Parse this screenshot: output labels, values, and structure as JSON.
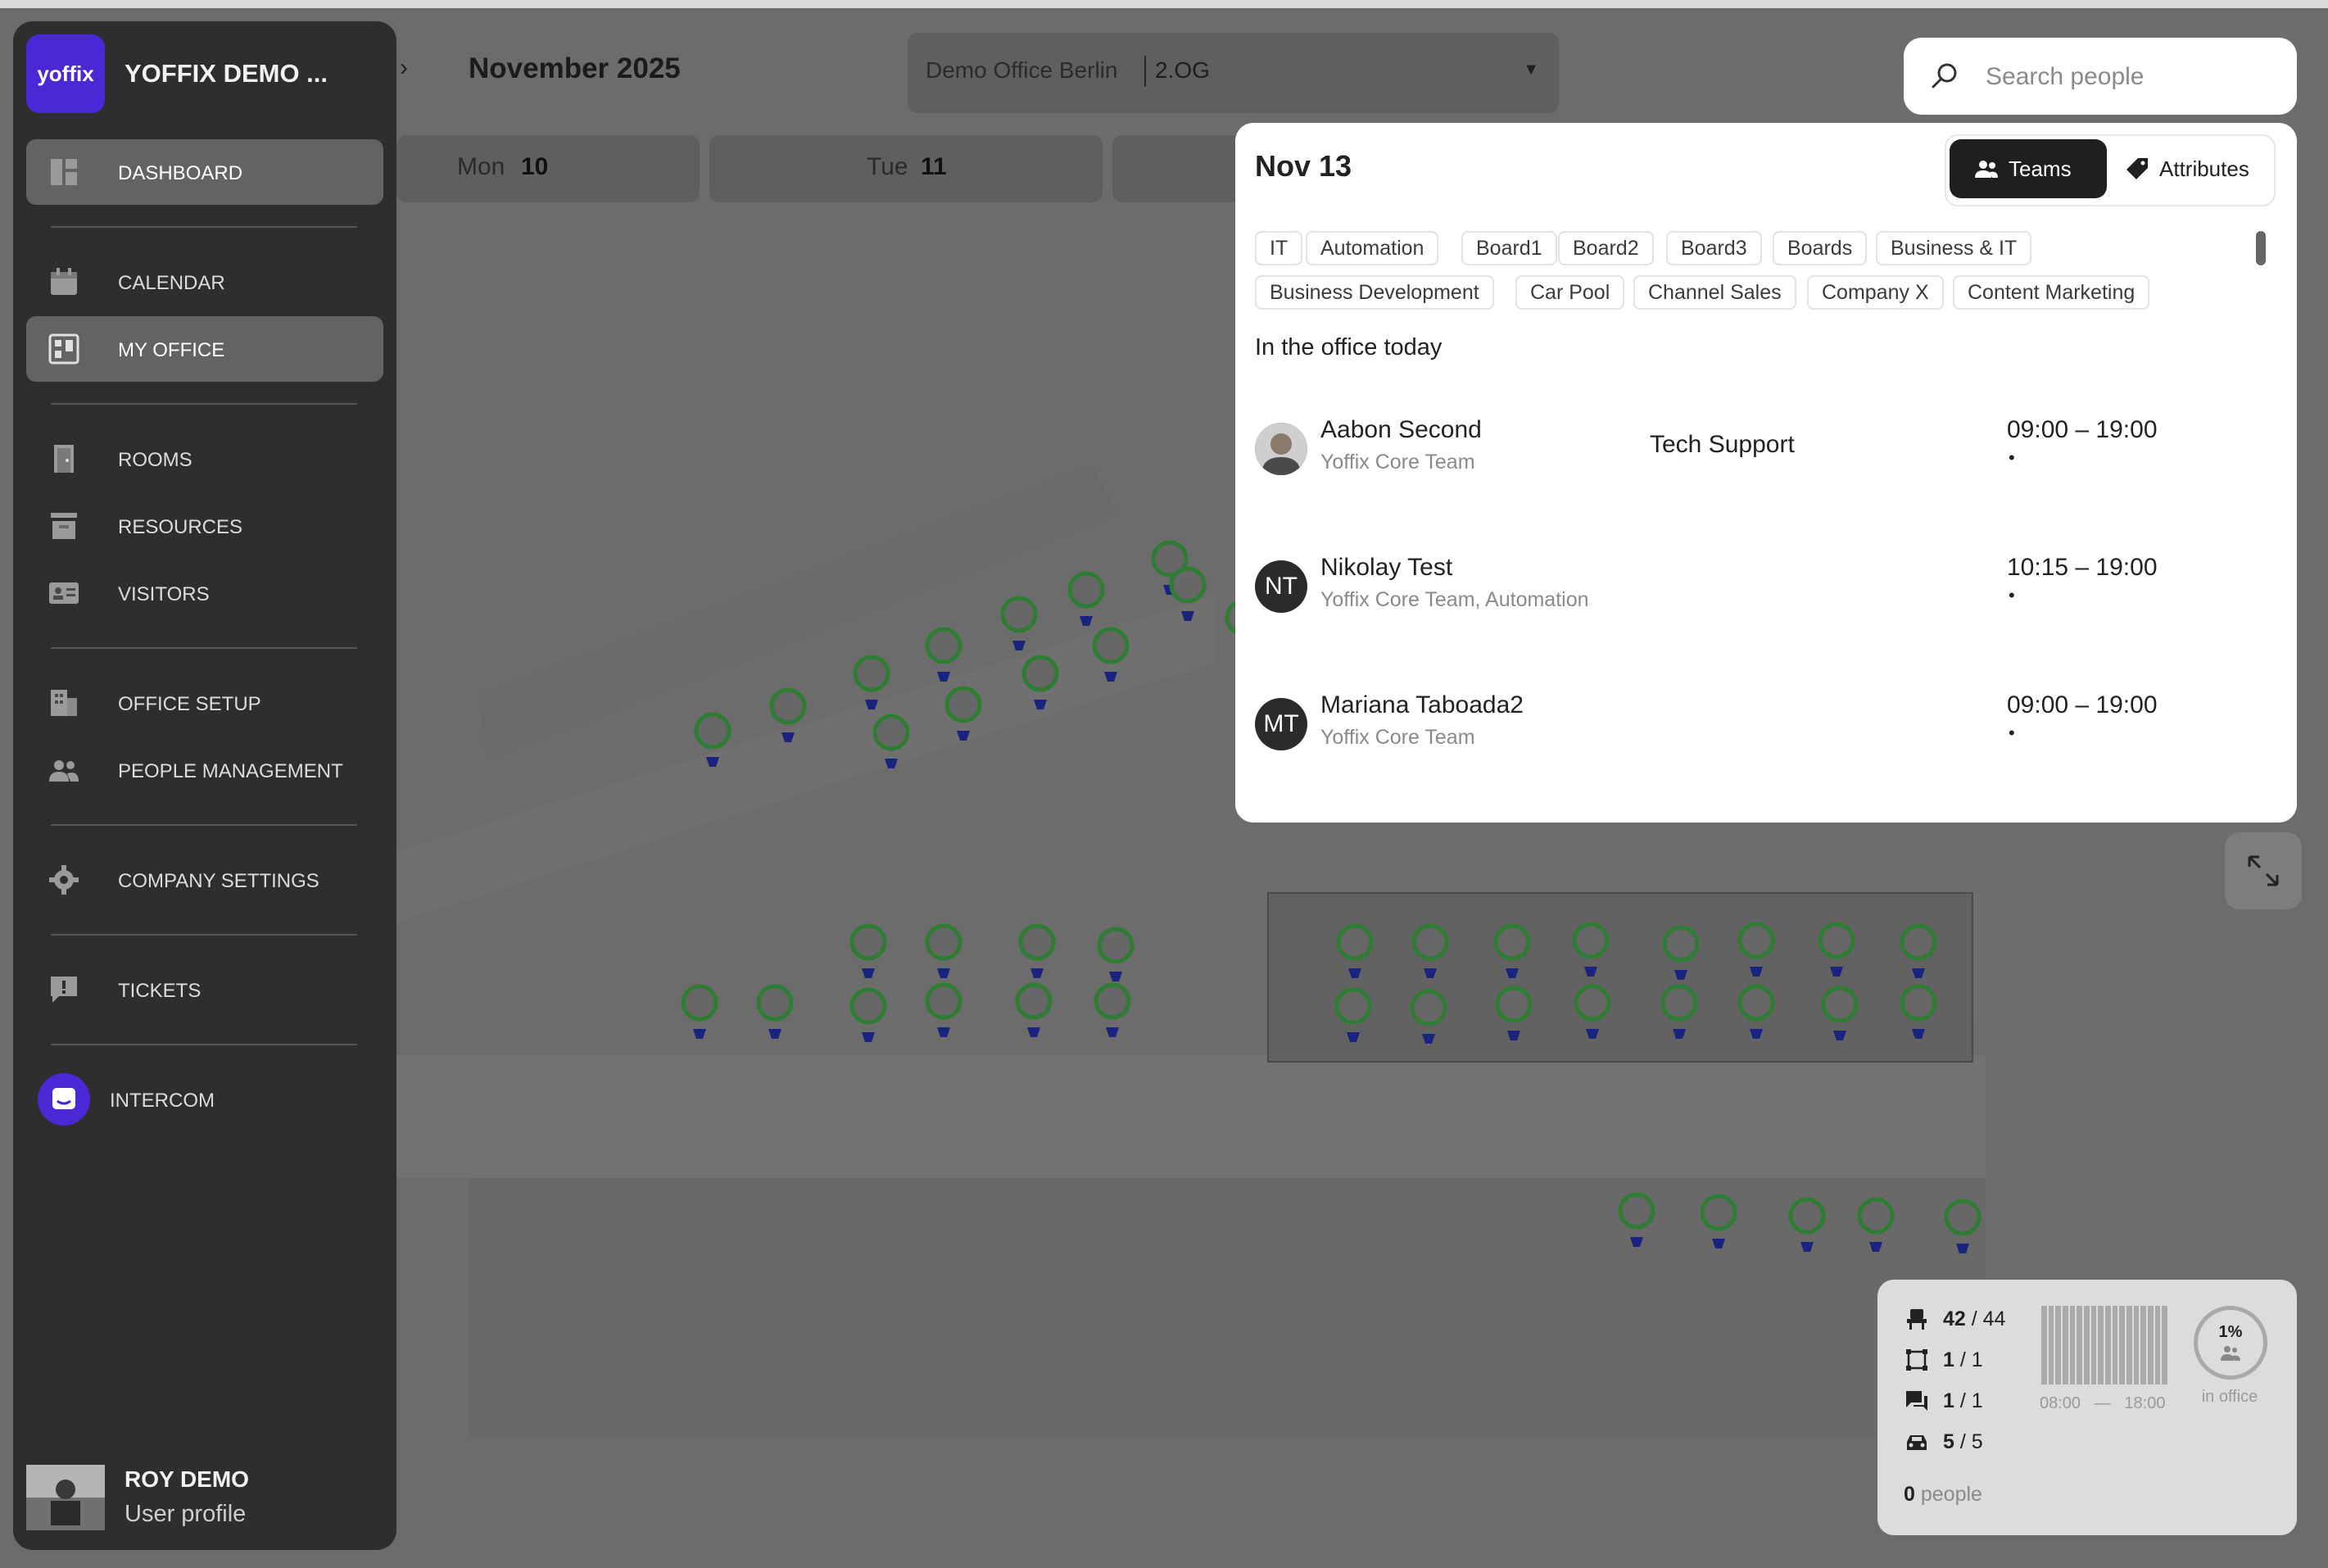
{
  "header": {
    "month_title": "November 2025",
    "location": "Demo Office Berlin",
    "floor": "2.OG",
    "search_placeholder": "Search people"
  },
  "days": [
    {
      "name": "Mon",
      "num": "10"
    },
    {
      "name": "Tue",
      "num": "11"
    }
  ],
  "sidebar": {
    "logo_text": "yoffix",
    "company": "YOFFIX DEMO ...",
    "items": [
      {
        "label": "DASHBOARD",
        "icon": "dashboard-icon"
      },
      {
        "label": "CALENDAR",
        "icon": "calendar-icon"
      },
      {
        "label": "MY OFFICE",
        "icon": "office-map-icon"
      },
      {
        "label": "ROOMS",
        "icon": "door-icon"
      },
      {
        "label": "RESOURCES",
        "icon": "resources-icon"
      },
      {
        "label": "VISITORS",
        "icon": "visitor-card-icon"
      },
      {
        "label": "OFFICE SETUP",
        "icon": "building-icon"
      },
      {
        "label": "PEOPLE MANAGEMENT",
        "icon": "people-icon"
      },
      {
        "label": "COMPANY SETTINGS",
        "icon": "gear-icon"
      },
      {
        "label": "TICKETS",
        "icon": "ticket-icon"
      }
    ],
    "intercom": "INTERCOM",
    "profile": {
      "name": "ROY DEMO",
      "sub": "User profile"
    }
  },
  "panel": {
    "date": "Nov 13",
    "seg_teams": "Teams",
    "seg_attributes": "Attributes",
    "tags": [
      "IT",
      "Automation",
      "Board1",
      "Board2",
      "Board3",
      "Boards",
      "Business & IT",
      "Business Development",
      "Car Pool",
      "Channel Sales",
      "Company X",
      "Content Marketing"
    ],
    "section_title": "In the office today",
    "people": [
      {
        "name": "Aabon Second",
        "team": "Yoffix Core Team",
        "desk": "Tech Support",
        "time": "09:00 – 19:00",
        "dot": "•",
        "initials": ""
      },
      {
        "name": "Nikolay Test",
        "team": "Yoffix Core Team, Automation",
        "desk": "",
        "time": "10:15 – 19:00",
        "dot": "•",
        "initials": "NT"
      },
      {
        "name": "Mariana Taboada2",
        "team": "Yoffix Core Team",
        "desk": "",
        "time": "09:00 – 19:00",
        "dot": "•",
        "initials": "MT"
      }
    ]
  },
  "stats": {
    "desks_used": "42",
    "desks_total": "/ 44",
    "rooms_used": "1",
    "rooms_total": "/ 1",
    "meeting_used": "1",
    "meeting_total": "/ 1",
    "parking_used": "5",
    "parking_total": "/ 5",
    "time_start": "08:00",
    "time_dash": "—",
    "time_end": "18:00",
    "percent": "1%",
    "percent_label": "in office",
    "people_count": "0",
    "people_label": "people"
  },
  "colors": {
    "brand": "#4a28d6",
    "sidebar": "#2e2e2e",
    "pin": "#2e7d32",
    "desk_mark": "#1a237e"
  }
}
